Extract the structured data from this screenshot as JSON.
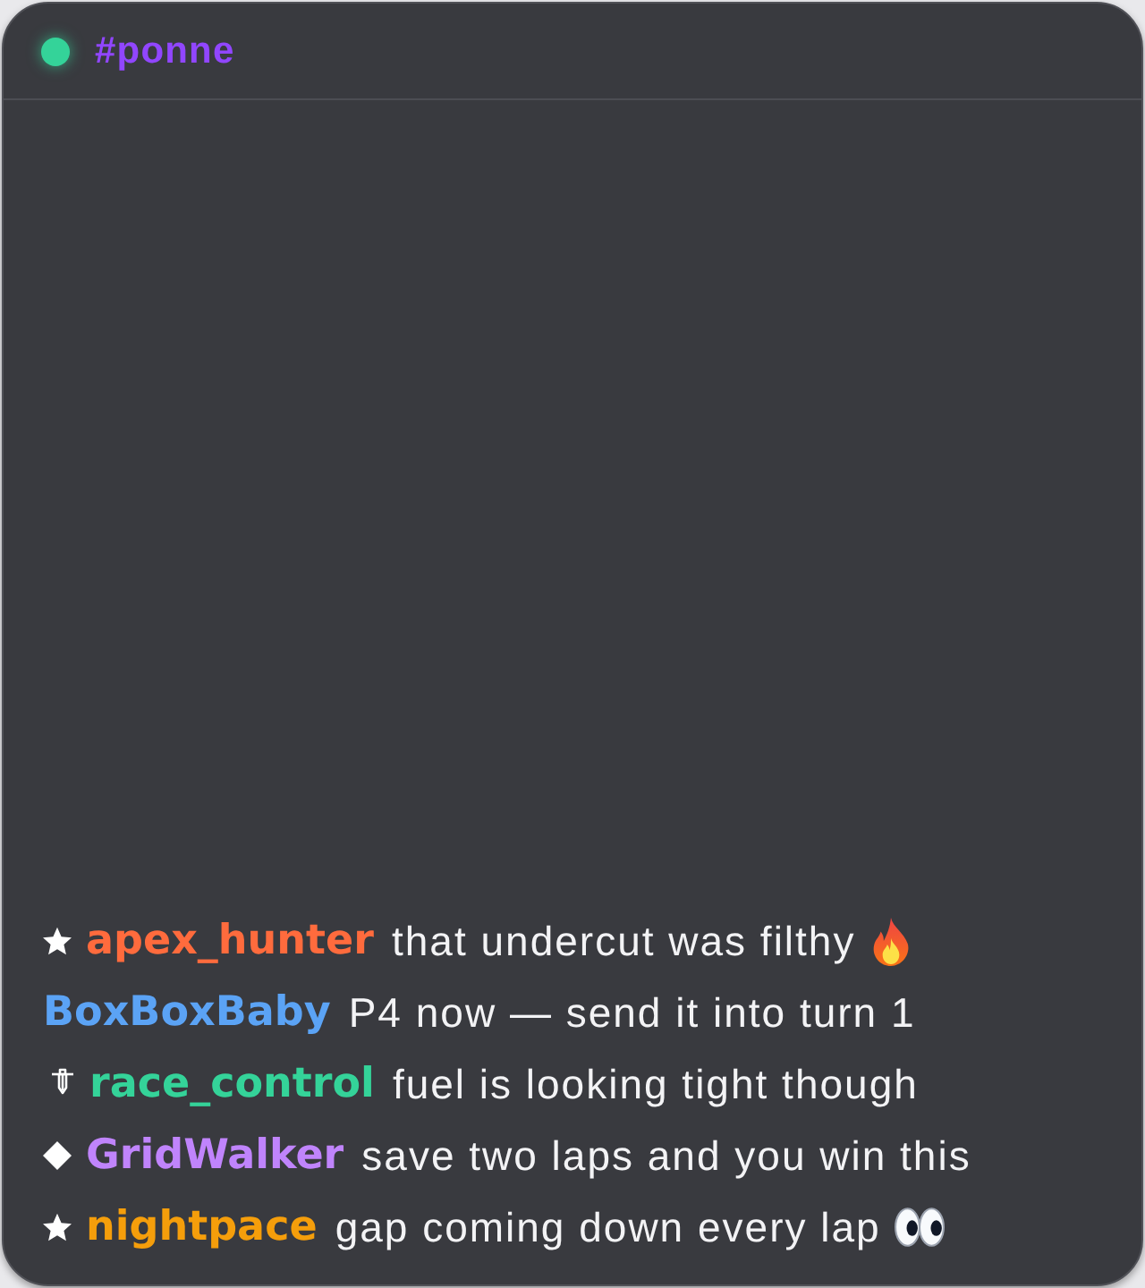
{
  "channel": {
    "name": "#ponne",
    "live": true
  },
  "messages": [
    {
      "badge": {
        "kind": "star"
      },
      "user": "apex_hunter",
      "color": "#ff6b3d",
      "text": "that undercut was filthy",
      "emoji": {
        "kind": "fire"
      }
    },
    {
      "user": "BoxBoxBaby",
      "color": "#5ba3f5",
      "text": "P4 now — send it into turn 1"
    },
    {
      "badge": {
        "kind": "dagger"
      },
      "user": "race_control",
      "color": "#34d399",
      "text": "fuel is looking tight though"
    },
    {
      "badge": {
        "kind": "diamond"
      },
      "user": "GridWalker",
      "color": "#c084fc",
      "text": "save two laps and you win this"
    },
    {
      "badge": {
        "kind": "star"
      },
      "user": "nightpace",
      "color": "#f59e0b",
      "text": "gap coming down every lap",
      "emoji": {
        "kind": "eyes"
      }
    }
  ]
}
